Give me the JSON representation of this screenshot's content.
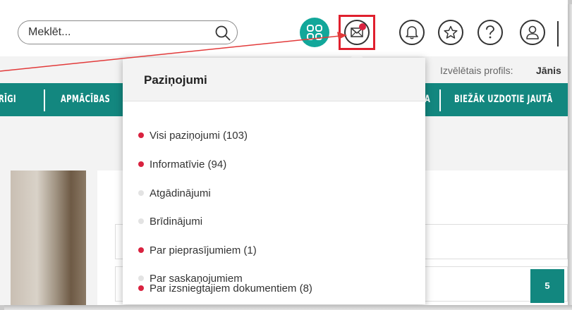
{
  "search": {
    "placeholder": "Meklēt..."
  },
  "header": {
    "icons": [
      "apps-icon",
      "mail-icon",
      "bell-icon",
      "star-icon",
      "help-icon",
      "user-icon"
    ],
    "accent": "#12a79a",
    "notification_dot": "#d9223f",
    "highlight": "#e0202e"
  },
  "profile": {
    "label": "Izvēlētais profils:",
    "name": "Jānis"
  },
  "nav": {
    "items": [
      "RĪGI",
      "APMĀCĪBAS",
      "A",
      "BIEŽĀK UZDOTIE JAUTĀ"
    ],
    "color": "#13877f"
  },
  "notifications": {
    "title": "Paziņojumi",
    "items": [
      {
        "label": "Visi paziņojumi (103)",
        "unread": true
      },
      {
        "label": "Informatīvie (94)",
        "unread": true
      },
      {
        "label": "Atgādinājumi",
        "unread": false
      },
      {
        "label": "Brīdinājumi",
        "unread": false
      },
      {
        "label": "Par pieprasījumiem (1)",
        "unread": true
      },
      {
        "label": "Par saskaņojumiem",
        "unread": false
      },
      {
        "label": "Par izsniegtajiem dokumentiem (8)",
        "unread": true
      }
    ]
  },
  "content": {
    "badge": "5"
  }
}
